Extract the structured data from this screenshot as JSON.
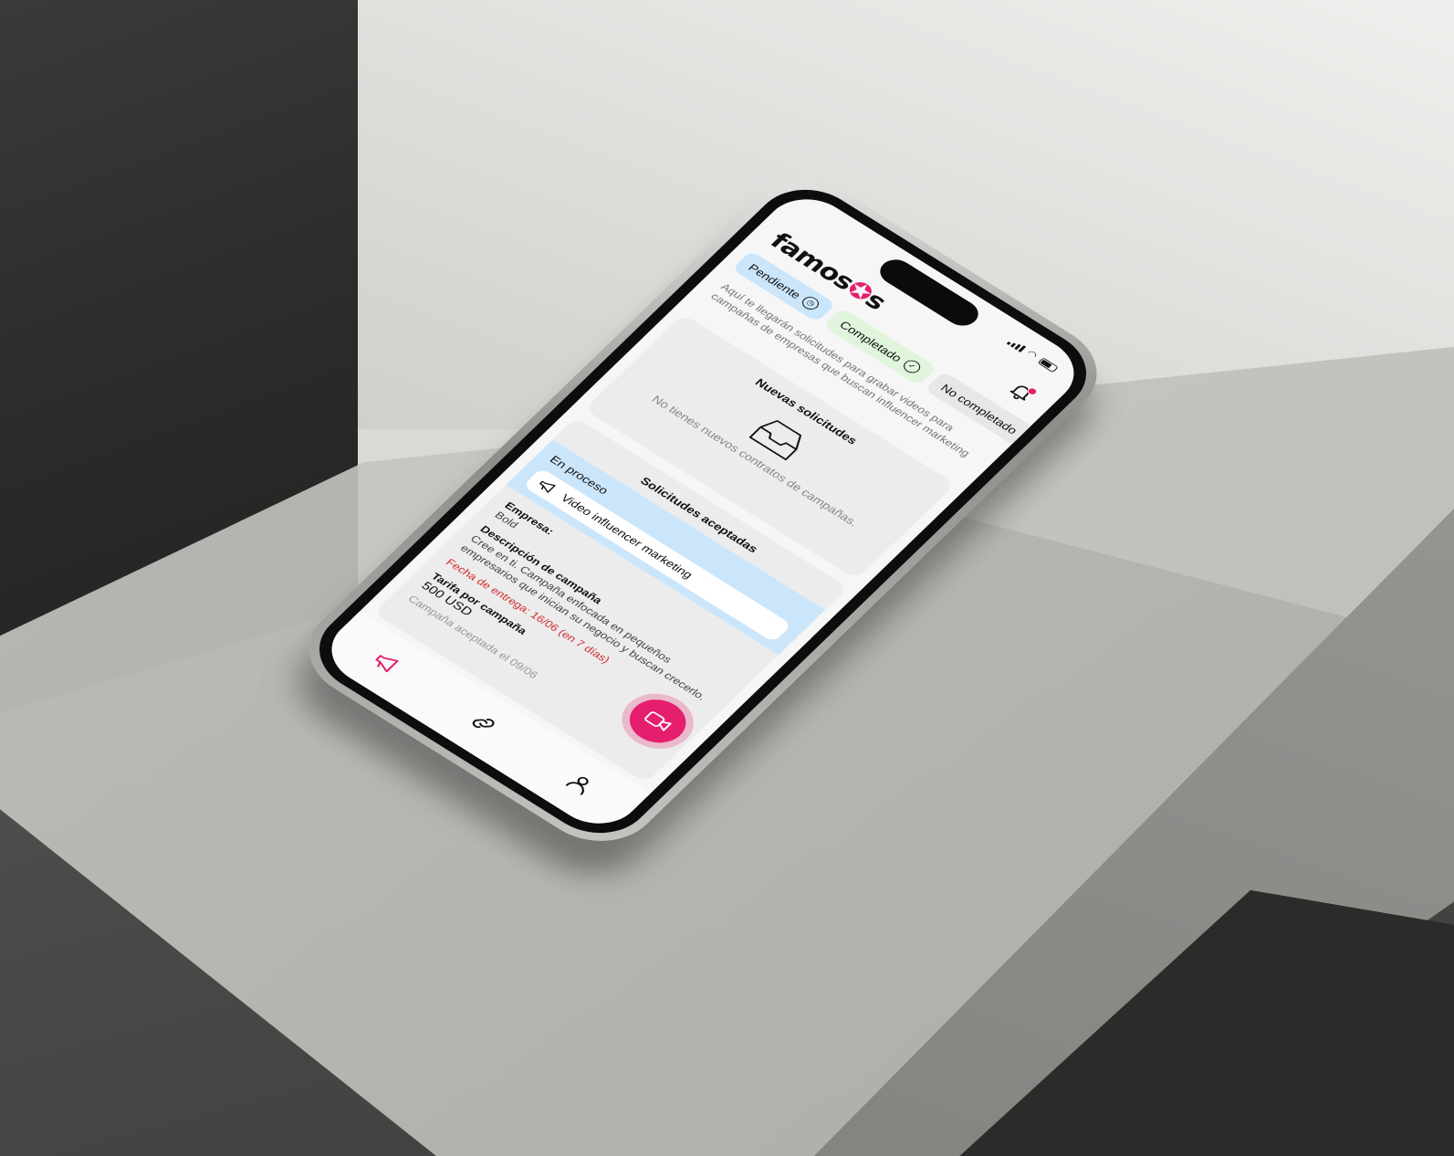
{
  "app": {
    "logo": "famosos",
    "colors": {
      "brand": "#e61e6e",
      "tab_pending": "#cbe6fb",
      "tab_completed": "#e1f5dc",
      "tab_not_completed": "#e7e7e7",
      "deadline": "#d42c2c"
    }
  },
  "header": {
    "logo_text_a": "famos",
    "logo_text_b": "s",
    "notification_icon": "bell-icon"
  },
  "tabs": [
    {
      "label": "Pendiente",
      "icon": "clock-icon",
      "selected": true
    },
    {
      "label": "Completado",
      "icon": "check-circle-icon",
      "selected": false
    },
    {
      "label": "No completado",
      "icon": "",
      "selected": false
    }
  ],
  "intro_text": "Aquí te llegarán solicitudes para grabar videos para campañas de empresas que buscan influencer marketing",
  "new_requests": {
    "title": "Nuevas solicitudes",
    "empty_icon": "inbox-icon",
    "empty_text": "No tienes nuevos contratos de campañas."
  },
  "accepted_requests": {
    "title": "Solicitudes aceptadas",
    "status_label": "En proceso",
    "campaign": {
      "icon": "megaphone-icon",
      "name": "Video influencer marketing",
      "company_label": "Empresa:",
      "company_value": "Bold",
      "description_label": "Descripción de campaña",
      "description_value": "Cree en ti. Campaña enfocada en pequeños empresarios que inician su negocio y buscan crecerlo.",
      "deadline_text": "Fecha de entrega: 16/06 (en 7 días)",
      "fee_label": "Tarifa por campaña",
      "fee_value": "500 USD",
      "accepted_text": "Campaña aceptada el 09/06"
    }
  },
  "fab": {
    "icon": "video-camera-icon"
  },
  "bottom_nav": [
    {
      "icon": "megaphone-icon",
      "active": true
    },
    {
      "icon": "link-icon",
      "active": false
    },
    {
      "icon": "user-icon",
      "active": false
    }
  ]
}
